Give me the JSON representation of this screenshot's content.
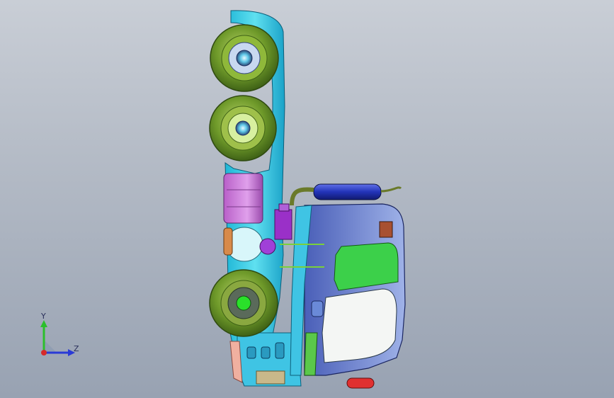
{
  "viewport": {
    "background_top": "#c9ced6",
    "background_bottom": "#98a2b2"
  },
  "triad": {
    "y_label": "Y",
    "z_label": "Z",
    "y_color": "#2bbf2b",
    "z_color": "#2a3ad6",
    "origin_color": "#d62a2a"
  },
  "model": {
    "description_icon": "truck-cad-model-side-view"
  }
}
